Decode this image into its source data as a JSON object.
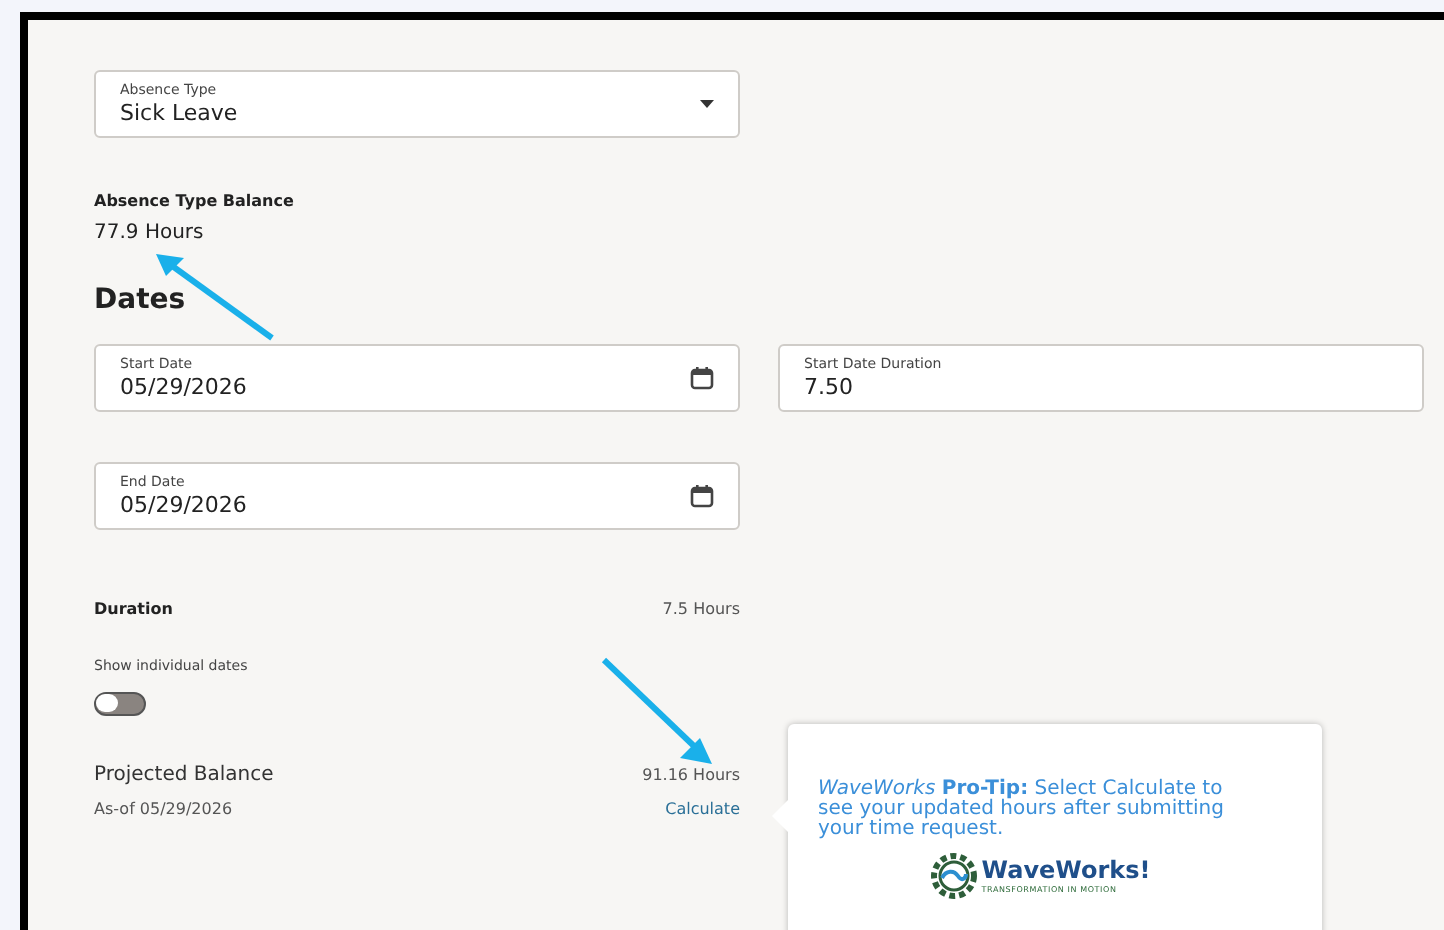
{
  "absence_type": {
    "label": "Absence Type",
    "value": "Sick Leave"
  },
  "balance": {
    "label": "Absence Type Balance",
    "value": "77.9 Hours"
  },
  "dates_heading": "Dates",
  "start_date": {
    "label": "Start Date",
    "value": "05/29/2026"
  },
  "start_date_duration": {
    "label": "Start Date Duration",
    "value": "7.50"
  },
  "end_date": {
    "label": "End Date",
    "value": "05/29/2026"
  },
  "duration": {
    "label": "Duration",
    "value": "7.5 Hours"
  },
  "show_individual_dates": {
    "label": "Show individual dates",
    "on": false
  },
  "projected_balance": {
    "label": "Projected Balance",
    "value": "91.16 Hours",
    "as_of": "As-of 05/29/2026",
    "action": "Calculate"
  },
  "tip": {
    "text": "*WaveWorks* **Pro-Tip:** Select Calculate to see your updated hours after submitting your time request.",
    "logo_name": "WaveWorks!",
    "logo_tagline": "TRANSFORMATION IN MOTION"
  }
}
